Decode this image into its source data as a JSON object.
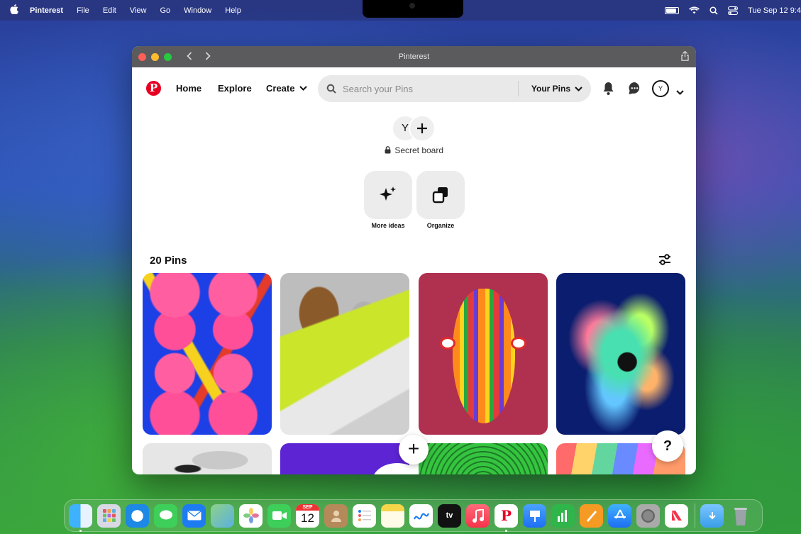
{
  "menubar": {
    "app_name": "Pinterest",
    "menus": [
      "File",
      "Edit",
      "View",
      "Go",
      "Window",
      "Help"
    ],
    "clock": "Tue Sep 12  9:4"
  },
  "window": {
    "title": "Pinterest"
  },
  "header": {
    "logo_letter": "P",
    "nav": {
      "home": "Home",
      "explore": "Explore",
      "create": "Create"
    },
    "search": {
      "placeholder": "Search your Pins",
      "scope": "Your Pins"
    },
    "user_initial": "Y"
  },
  "board": {
    "collaborator_initial": "Y",
    "visibility_label": "Secret board",
    "actions": [
      {
        "label": "More ideas",
        "icon": "sparkle-icon"
      },
      {
        "label": "Organize",
        "icon": "organize-icon"
      }
    ],
    "pin_count_label": "20 Pins"
  },
  "pins": [
    {
      "description": "pink blobs on blue abstract art"
    },
    {
      "description": "3D wooden and chrome objects on lime platform"
    },
    {
      "description": "colorful striped mask face"
    },
    {
      "description": "iridescent fluid explosion on navy"
    },
    {
      "description": "chrome abstract"
    },
    {
      "description": "purple background with white shape"
    },
    {
      "description": "green maze pattern"
    },
    {
      "description": "rainbow fabric texture"
    }
  ],
  "fab": {
    "add": "+",
    "help": "?"
  },
  "dock": {
    "calendar_month": "SEP",
    "calendar_day": "12",
    "apps": [
      "finder",
      "launchpad",
      "safari",
      "messages",
      "mail",
      "maps",
      "photos",
      "facetime",
      "calendar",
      "contacts",
      "reminders",
      "notes",
      "freeform",
      "tv",
      "music",
      "pinterest",
      "keynote",
      "numbers",
      "pages",
      "app-store",
      "system-settings",
      "news"
    ]
  },
  "colors": {
    "pinterest_red": "#e60023",
    "titlebar": "#5b5b5e"
  }
}
